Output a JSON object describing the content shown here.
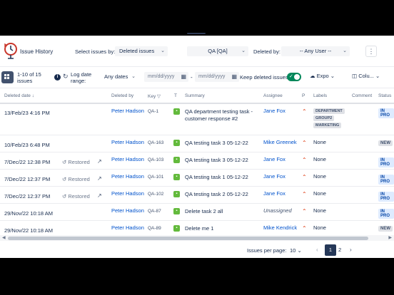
{
  "header": {
    "title": "Issue History",
    "select_issues_label": "Select issues by:",
    "issues_filter": "Deleted issues",
    "project": "QA [QA]",
    "deleted_by_label": "Deleted by:",
    "user_filter": "-- Any User --"
  },
  "toolbar": {
    "count_line1": "1-10 of 15",
    "count_line2": "issues",
    "log_date_line1": "Log date",
    "log_date_line2": "range:",
    "dates_filter": "Any dates",
    "date_from_placeholder": "mm/dd/yyyy",
    "date_sep": "-",
    "date_to_placeholder": "mm/dd/yyyy",
    "keep_deleted_label": "Keep deleted issues",
    "keep_deleted_on": true,
    "export_label": "Expo",
    "columns_label": "Colu..."
  },
  "columns": {
    "deleted_date": "Deleted date",
    "deleted_by": "Deleted by",
    "key": "Key",
    "type": "T",
    "summary": "Summary",
    "assignee": "Assignee",
    "priority": "P",
    "labels": "Labels",
    "comment": "Comment",
    "status": "Status"
  },
  "rows": [
    {
      "date": "13/Feb/23 4:16 PM",
      "restored": "",
      "deleted_by": "Peter Hadson",
      "key": "QA-1",
      "summary": "QA department testing task - customer response #2",
      "assignee": "Jane Fox",
      "labels": [
        "DEPARTMENT",
        "GROUP2",
        "MARKETING"
      ],
      "status": "IN PRO"
    },
    {
      "date": "10/Feb/23 6:48 PM",
      "restored": "",
      "deleted_by": "Peter Hadson",
      "key": "QA-163",
      "summary": "QA testing task 3 05-12-22",
      "assignee": "Mike Greenek",
      "label_text": "None",
      "status": "NEW"
    },
    {
      "date": "7/Dec/22 12:38 PM",
      "restored": "Restored",
      "deleted_by": "Peter Hadson",
      "key": "QA-103",
      "summary": "QA testing task 3 05-12-22",
      "assignee": "Jane Fox",
      "label_text": "None",
      "status": "IN PRO"
    },
    {
      "date": "7/Dec/22 12:37 PM",
      "restored": "Restored",
      "deleted_by": "Peter Hadson",
      "key": "QA-101",
      "summary": "QA testing task 1 05-12-22",
      "assignee": "Jane Fox",
      "label_text": "None",
      "status": "IN PRO"
    },
    {
      "date": "7/Dec/22 12:37 PM",
      "restored": "Restored",
      "deleted_by": "Peter Hadson",
      "key": "QA-102",
      "summary": "QA testing task 2 05-12-22",
      "assignee": "Jane Fox",
      "label_text": "None",
      "status": "IN PRO"
    },
    {
      "date": "29/Nov/22 10:18 AM",
      "restored": "",
      "deleted_by": "Peter Hadson",
      "key": "QA-87",
      "summary": "Delete task 2 all",
      "assignee": "Unassigned",
      "label_text": "None",
      "status": "IN PRO"
    },
    {
      "date": "29/Nov/22 10:18 AM",
      "restored": "",
      "deleted_by": "Peter Hadson",
      "key": "QA-89",
      "summary": "Delete me 1",
      "assignee": "Mike Kendrick",
      "label_text": "None",
      "status": "NEW"
    }
  ],
  "pagination": {
    "per_page_label": "Issues per page:",
    "per_page": "10",
    "current_page": "1",
    "next_page": "2"
  },
  "colors": {
    "accent": "#0052cc",
    "toggle_on": "#00875a",
    "story_type": "#63ba3c",
    "priority": "#de350b"
  },
  "icons": [
    "clock-history-logo-icon",
    "chevron-down-icon",
    "more-icon",
    "grid-icon",
    "info-icon",
    "refresh-icon",
    "calendar-icon",
    "check-icon",
    "cloud-export-icon",
    "columns-icon",
    "sort-down-icon",
    "filter-icon",
    "story-icon",
    "restore-icon",
    "external-link-icon",
    "priority-high-icon"
  ]
}
